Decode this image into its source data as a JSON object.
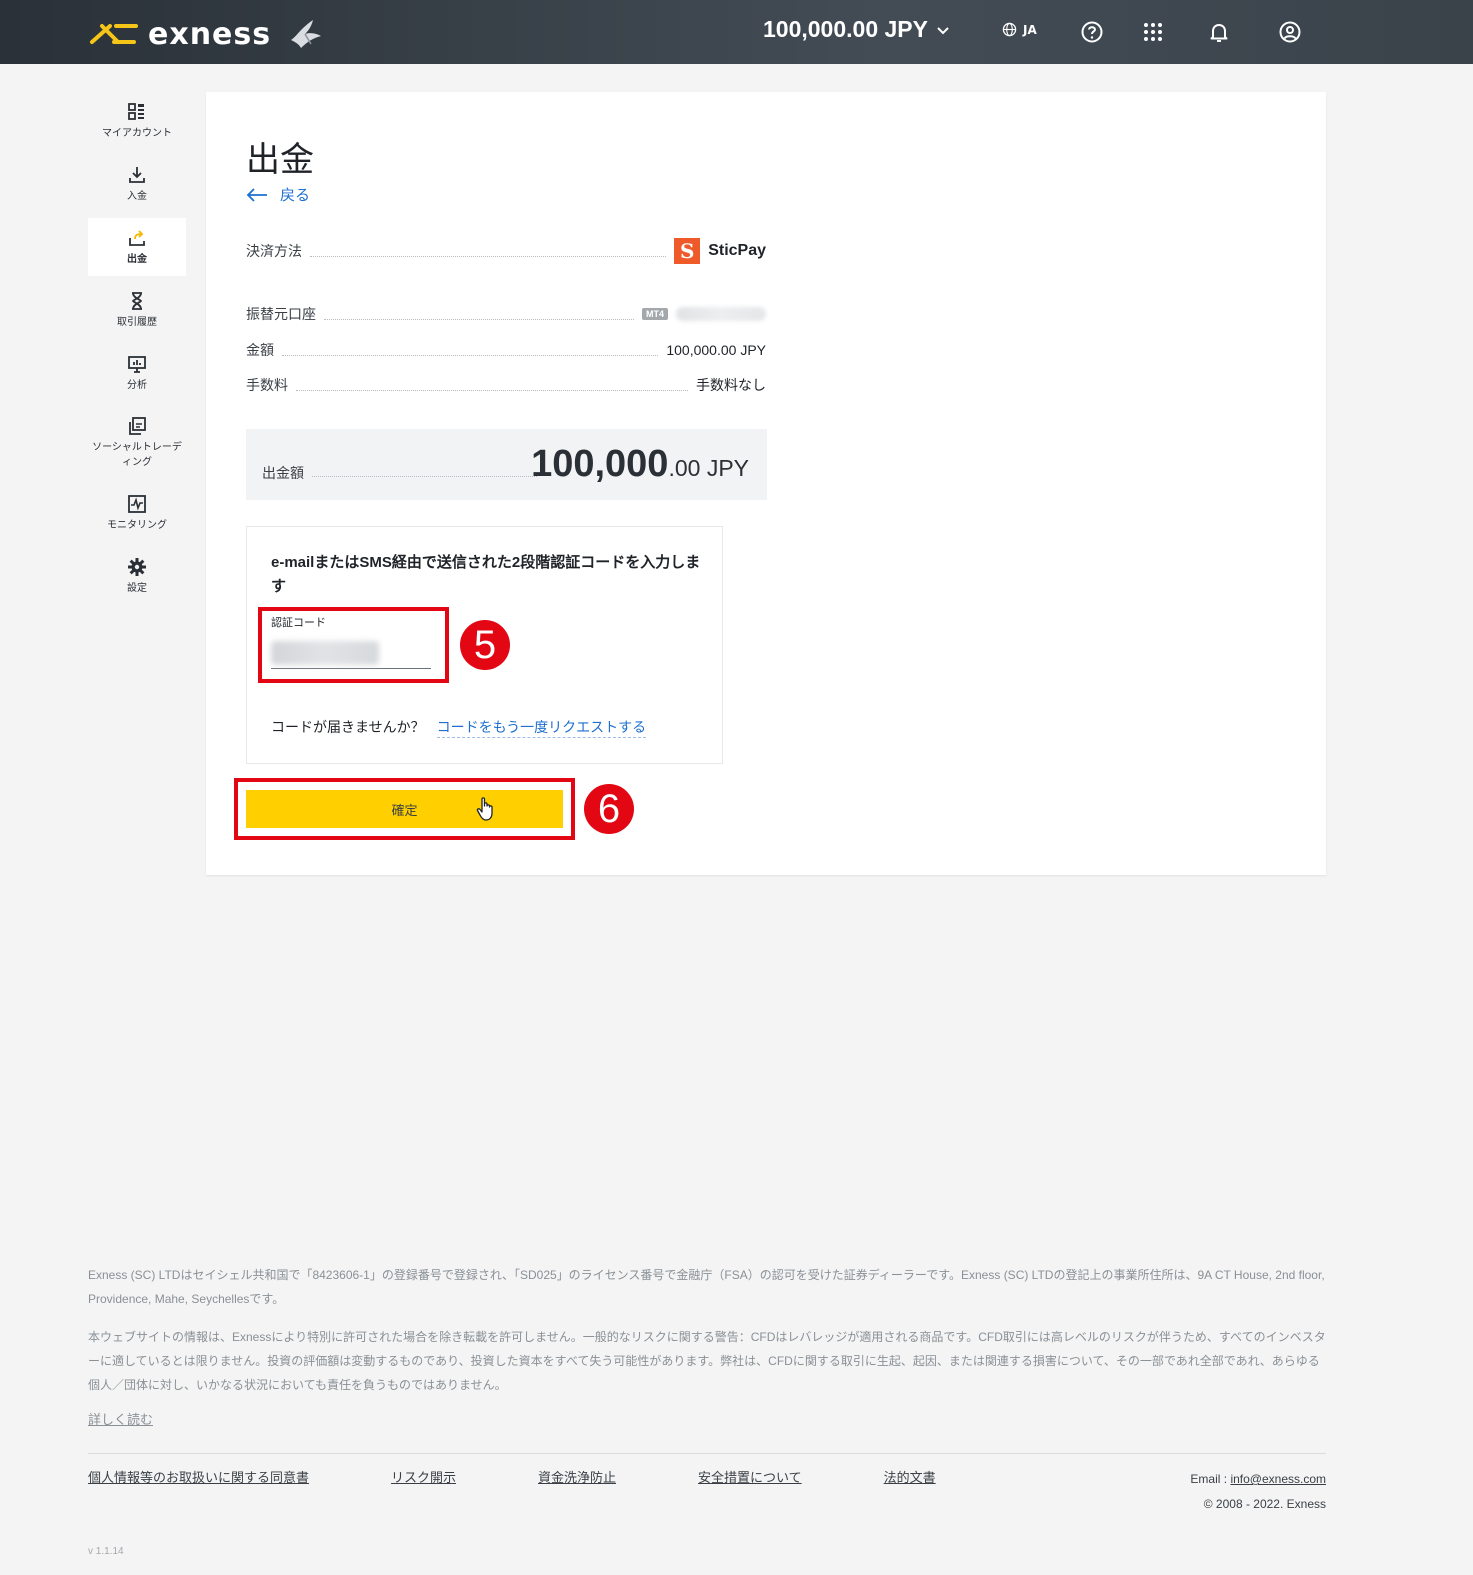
{
  "header": {
    "logo_text": "exness",
    "balance": "100,000.00 JPY",
    "language": "JA"
  },
  "sidebar": {
    "items": [
      {
        "label": "マイアカウント",
        "icon": "dashboard-icon"
      },
      {
        "label": "入金",
        "icon": "download-icon"
      },
      {
        "label": "出金",
        "icon": "upload-icon",
        "active": true
      },
      {
        "label": "取引履歴",
        "icon": "hourglass-icon"
      },
      {
        "label": "分析",
        "icon": "analytics-icon"
      },
      {
        "label": "ソーシャルトレーディング",
        "icon": "copy-icon"
      },
      {
        "label": "モニタリング",
        "icon": "monitoring-icon"
      },
      {
        "label": "設定",
        "icon": "gear-icon"
      }
    ]
  },
  "main": {
    "title": "出金",
    "back_label": "戻る",
    "payment_method_label": "決済方法",
    "payment_method_value": "SticPay",
    "account_label": "振替元口座",
    "account_badge": "MT4",
    "amount_label": "金額",
    "amount_value": "100,000.00 JPY",
    "fee_label": "手数料",
    "fee_value": "手数料なし",
    "total_label": "出金額",
    "total_integer": "100,000",
    "total_decimal": ".00 JPY",
    "verify_text": "e-mailまたはSMS経由で送信された2段階認証コードを入力します",
    "code_label": "認証コード",
    "resend_question": "コードが届きませんか？",
    "resend_link": "コードをもう一度リクエストする",
    "confirm_label": "確定",
    "step5": "5",
    "step6": "6"
  },
  "footer": {
    "legal1": "Exness (SC) LTDはセイシェル共和国で「8423606-1」の登録番号で登録され、「SD025」のライセンス番号で金融庁（FSA）の認可を受けた証券ディーラーです。Exness (SC) LTDの登記上の事業所住所は、9A CT House, 2nd floor, Providence, Mahe, Seychellesです。",
    "legal2": "本ウェブサイトの情報は、Exnessにより特別に許可された場合を除き転載を許可しません。一般的なリスクに関する警告：CFDはレバレッジが適用される商品です。CFD取引には高レベルのリスクが伴うため、すべてのインベスターに適しているとは限りません。投資の評価額は変動するものであり、投資した資本をすべて失う可能性があります。弊社は、CFDに関する取引に生起、起因、または関連する損害について、その一部であれ全部であれ、あらゆる個人／団体に対し、いかなる状況においても責任を負うものではありません。",
    "read_more": "詳しく読む",
    "links": [
      "個人情報等のお取扱いに関する同意書",
      "リスク開示",
      "資金洗浄防止",
      "安全措置について",
      "法的文書"
    ],
    "email_label": "Email : ",
    "email": "info@exness.com",
    "copyright": "© 2008 - 2022. Exness",
    "version": "v 1.1.14"
  }
}
